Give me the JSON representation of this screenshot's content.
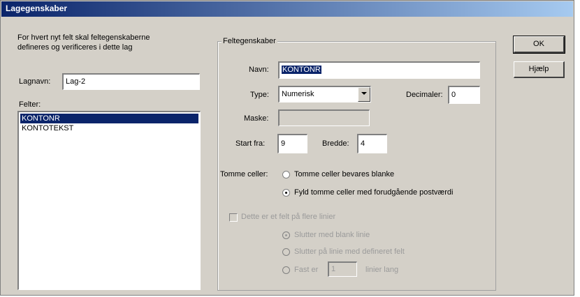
{
  "window": {
    "title": "Lagegenskaber"
  },
  "left": {
    "description_line1": "For hvert nyt felt skal feltegenskaberne",
    "description_line2": "defineres og verificeres i dette lag",
    "layername_label": "Lagnavn:",
    "layername_value": "Lag-2",
    "fields_label": "Felter:",
    "fields": [
      {
        "label": "KONTONR",
        "selected": true
      },
      {
        "label": "KONTOTEKST",
        "selected": false
      }
    ]
  },
  "props": {
    "group_label": "Feltegenskaber",
    "name_label": "Navn:",
    "name_value": "KONTONR",
    "type_label": "Type:",
    "type_value": "Numerisk",
    "decimals_label": "Decimaler:",
    "decimals_value": "0",
    "mask_label": "Maske:",
    "mask_value": "",
    "start_label": "Start fra:",
    "start_value": "9",
    "width_label": "Bredde:",
    "width_value": "4",
    "empty_label": "Tomme celler:",
    "empty_opt1": "Tomme celler bevares blanke",
    "empty_opt2": "Fyld tomme celler med forudgående postværdi",
    "multiline_label": "Dette er et felt på flere linier",
    "ml_opt1": "Slutter med blank linie",
    "ml_opt2": "Slutter på linie med defineret felt",
    "ml_opt3_prefix": "Fast er",
    "ml_opt3_value": "1",
    "ml_opt3_suffix": "linier lang"
  },
  "buttons": {
    "ok": "OK",
    "help": "Hjælp"
  }
}
